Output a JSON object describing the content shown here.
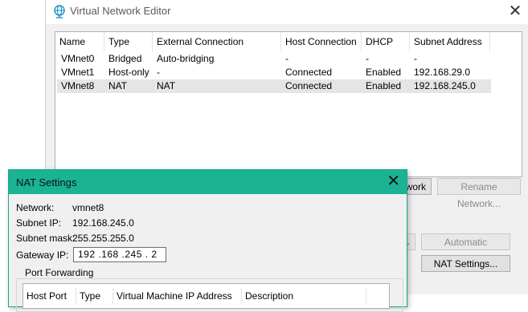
{
  "vne": {
    "title": "Virtual Network Editor",
    "icon": "globe-icon",
    "columns": [
      "Name",
      "Type",
      "External Connection",
      "Host Connection",
      "DHCP",
      "Subnet Address"
    ],
    "rows": [
      {
        "name": "VMnet0",
        "type": "Bridged",
        "external": "Auto-bridging",
        "host": "-",
        "dhcp": "-",
        "subnet": "-"
      },
      {
        "name": "VMnet1",
        "type": "Host-only",
        "external": "-",
        "host": "Connected",
        "dhcp": "Enabled",
        "subnet": "192.168.29.0"
      },
      {
        "name": "VMnet8",
        "type": "NAT",
        "external": "NAT",
        "host": "Connected",
        "dhcp": "Enabled",
        "subnet": "192.168.245.0"
      }
    ],
    "selected_row": "VMnet8",
    "add_network_partial": "work",
    "rename_network": "Rename Network...",
    "automatic_settings": "Automatic Settings...",
    "nat_settings": "NAT Settings..."
  },
  "nat": {
    "title": "NAT Settings",
    "network_label": "Network:",
    "network_value": "vmnet8",
    "subnet_ip_label": "Subnet IP:",
    "subnet_ip_value": "192.168.245.0",
    "subnet_mask_label": "Subnet mask:",
    "subnet_mask_value": "255.255.255.0",
    "gateway_label": "Gateway IP:",
    "gateway_value": "192 .168 .245 .  2",
    "port_forwarding_label": "Port Forwarding",
    "pf_columns": [
      "Host Port",
      "Type",
      "Virtual Machine IP Address",
      "Description"
    ]
  },
  "colors": {
    "nat_titlebar": "#1ab394",
    "selected_row": "#e5e5e5"
  }
}
